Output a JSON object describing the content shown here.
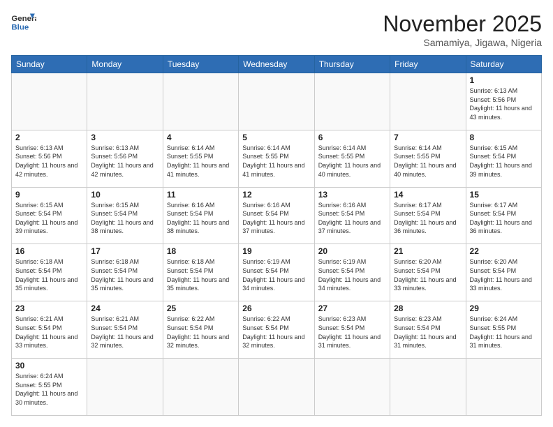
{
  "header": {
    "logo_general": "General",
    "logo_blue": "Blue",
    "month_title": "November 2025",
    "location": "Samamiya, Jigawa, Nigeria"
  },
  "days_of_week": [
    "Sunday",
    "Monday",
    "Tuesday",
    "Wednesday",
    "Thursday",
    "Friday",
    "Saturday"
  ],
  "weeks": [
    [
      {
        "day": "",
        "info": ""
      },
      {
        "day": "",
        "info": ""
      },
      {
        "day": "",
        "info": ""
      },
      {
        "day": "",
        "info": ""
      },
      {
        "day": "",
        "info": ""
      },
      {
        "day": "",
        "info": ""
      },
      {
        "day": "1",
        "info": "Sunrise: 6:13 AM\nSunset: 5:56 PM\nDaylight: 11 hours and 43 minutes."
      }
    ],
    [
      {
        "day": "2",
        "info": "Sunrise: 6:13 AM\nSunset: 5:56 PM\nDaylight: 11 hours and 42 minutes."
      },
      {
        "day": "3",
        "info": "Sunrise: 6:13 AM\nSunset: 5:56 PM\nDaylight: 11 hours and 42 minutes."
      },
      {
        "day": "4",
        "info": "Sunrise: 6:14 AM\nSunset: 5:55 PM\nDaylight: 11 hours and 41 minutes."
      },
      {
        "day": "5",
        "info": "Sunrise: 6:14 AM\nSunset: 5:55 PM\nDaylight: 11 hours and 41 minutes."
      },
      {
        "day": "6",
        "info": "Sunrise: 6:14 AM\nSunset: 5:55 PM\nDaylight: 11 hours and 40 minutes."
      },
      {
        "day": "7",
        "info": "Sunrise: 6:14 AM\nSunset: 5:55 PM\nDaylight: 11 hours and 40 minutes."
      },
      {
        "day": "8",
        "info": "Sunrise: 6:15 AM\nSunset: 5:54 PM\nDaylight: 11 hours and 39 minutes."
      }
    ],
    [
      {
        "day": "9",
        "info": "Sunrise: 6:15 AM\nSunset: 5:54 PM\nDaylight: 11 hours and 39 minutes."
      },
      {
        "day": "10",
        "info": "Sunrise: 6:15 AM\nSunset: 5:54 PM\nDaylight: 11 hours and 38 minutes."
      },
      {
        "day": "11",
        "info": "Sunrise: 6:16 AM\nSunset: 5:54 PM\nDaylight: 11 hours and 38 minutes."
      },
      {
        "day": "12",
        "info": "Sunrise: 6:16 AM\nSunset: 5:54 PM\nDaylight: 11 hours and 37 minutes."
      },
      {
        "day": "13",
        "info": "Sunrise: 6:16 AM\nSunset: 5:54 PM\nDaylight: 11 hours and 37 minutes."
      },
      {
        "day": "14",
        "info": "Sunrise: 6:17 AM\nSunset: 5:54 PM\nDaylight: 11 hours and 36 minutes."
      },
      {
        "day": "15",
        "info": "Sunrise: 6:17 AM\nSunset: 5:54 PM\nDaylight: 11 hours and 36 minutes."
      }
    ],
    [
      {
        "day": "16",
        "info": "Sunrise: 6:18 AM\nSunset: 5:54 PM\nDaylight: 11 hours and 35 minutes."
      },
      {
        "day": "17",
        "info": "Sunrise: 6:18 AM\nSunset: 5:54 PM\nDaylight: 11 hours and 35 minutes."
      },
      {
        "day": "18",
        "info": "Sunrise: 6:18 AM\nSunset: 5:54 PM\nDaylight: 11 hours and 35 minutes."
      },
      {
        "day": "19",
        "info": "Sunrise: 6:19 AM\nSunset: 5:54 PM\nDaylight: 11 hours and 34 minutes."
      },
      {
        "day": "20",
        "info": "Sunrise: 6:19 AM\nSunset: 5:54 PM\nDaylight: 11 hours and 34 minutes."
      },
      {
        "day": "21",
        "info": "Sunrise: 6:20 AM\nSunset: 5:54 PM\nDaylight: 11 hours and 33 minutes."
      },
      {
        "day": "22",
        "info": "Sunrise: 6:20 AM\nSunset: 5:54 PM\nDaylight: 11 hours and 33 minutes."
      }
    ],
    [
      {
        "day": "23",
        "info": "Sunrise: 6:21 AM\nSunset: 5:54 PM\nDaylight: 11 hours and 33 minutes."
      },
      {
        "day": "24",
        "info": "Sunrise: 6:21 AM\nSunset: 5:54 PM\nDaylight: 11 hours and 32 minutes."
      },
      {
        "day": "25",
        "info": "Sunrise: 6:22 AM\nSunset: 5:54 PM\nDaylight: 11 hours and 32 minutes."
      },
      {
        "day": "26",
        "info": "Sunrise: 6:22 AM\nSunset: 5:54 PM\nDaylight: 11 hours and 32 minutes."
      },
      {
        "day": "27",
        "info": "Sunrise: 6:23 AM\nSunset: 5:54 PM\nDaylight: 11 hours and 31 minutes."
      },
      {
        "day": "28",
        "info": "Sunrise: 6:23 AM\nSunset: 5:54 PM\nDaylight: 11 hours and 31 minutes."
      },
      {
        "day": "29",
        "info": "Sunrise: 6:24 AM\nSunset: 5:55 PM\nDaylight: 11 hours and 31 minutes."
      }
    ],
    [
      {
        "day": "30",
        "info": "Sunrise: 6:24 AM\nSunset: 5:55 PM\nDaylight: 11 hours and 30 minutes."
      },
      {
        "day": "",
        "info": ""
      },
      {
        "day": "",
        "info": ""
      },
      {
        "day": "",
        "info": ""
      },
      {
        "day": "",
        "info": ""
      },
      {
        "day": "",
        "info": ""
      },
      {
        "day": "",
        "info": ""
      }
    ]
  ]
}
